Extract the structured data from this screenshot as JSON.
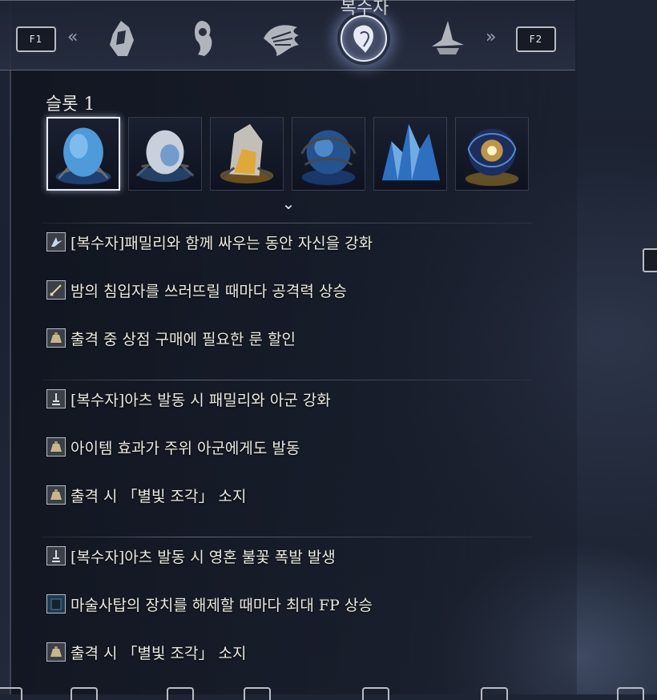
{
  "topbar": {
    "prev_key": "F1",
    "next_key": "F2",
    "prev_chevron": "«",
    "next_chevron": "»",
    "active_class_label": "복수자",
    "classes": [
      {
        "icon": "hooded-warrior-icon"
      },
      {
        "icon": "hooded-figure-icon"
      },
      {
        "icon": "feathered-crest-icon"
      },
      {
        "icon": "revenant-icon",
        "active": true
      },
      {
        "icon": "wizard-hat-icon"
      }
    ]
  },
  "slot": {
    "title": "슬롯 1",
    "expand_icon": "chevron-down-icon",
    "relics": [
      {
        "name": "blue-egg-relic",
        "selected": true
      },
      {
        "name": "white-egg-relic"
      },
      {
        "name": "amber-crystal-relic"
      },
      {
        "name": "blue-orb-relic"
      },
      {
        "name": "blue-crystal-relic"
      },
      {
        "name": "golden-orb-relic"
      }
    ]
  },
  "effect_groups": [
    {
      "effects": [
        {
          "icon": "sparkle-icon",
          "text": "[복수자]패밀리와 함께 싸우는 동안 자신을 강화"
        },
        {
          "icon": "sword-icon",
          "text": "밤의 침입자를 쓰러뜨릴 때마다 공격력 상승"
        },
        {
          "icon": "rune-bag-icon",
          "text": "출격 중 상점 구매에 필요한 룬 할인"
        }
      ]
    },
    {
      "effects": [
        {
          "icon": "arts-icon",
          "text": "[복수자]아츠 발동 시 패밀리와 아군 강화"
        },
        {
          "icon": "rune-bag-icon",
          "text": "아이템 효과가 주위 아군에게도 발동"
        },
        {
          "icon": "rune-bag-icon",
          "text": "출격 시 「별빛 조각」 소지"
        }
      ]
    },
    {
      "effects": [
        {
          "icon": "arts-icon",
          "text": "[복수자]아츠 발동 시 영혼 불꽃 폭발 발생"
        },
        {
          "icon": "tower-icon",
          "text": "마술사탑의 장치를 해제할 때마다 최대 FP 상승"
        },
        {
          "icon": "rune-bag-icon",
          "text": "출격 시 「별빛 조각」 소지"
        }
      ]
    }
  ],
  "colors": {
    "background": "#1d2434",
    "text": "#ebe9e2",
    "accent_glow": "#aabeff"
  }
}
